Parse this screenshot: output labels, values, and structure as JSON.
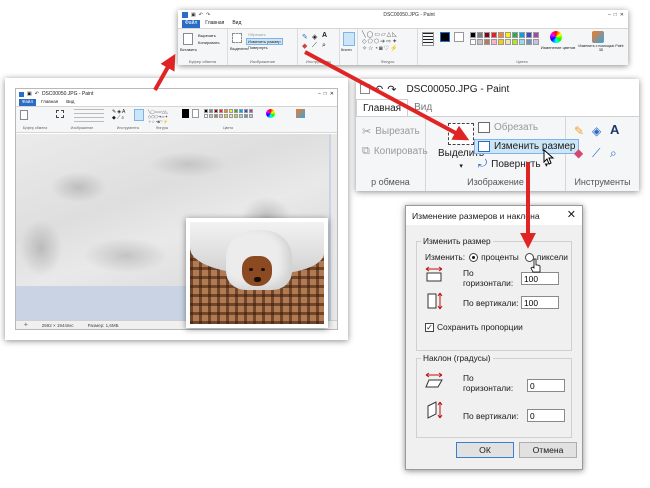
{
  "top_strip": {
    "title": "DSC00050.JPG - Paint",
    "tabs": [
      "Файл",
      "Главная",
      "Вид"
    ],
    "groups": [
      "Буфер обмена",
      "Изображение",
      "Инструменты",
      "Фигуры",
      "Цвета"
    ],
    "labels": {
      "cut": "Вырезать",
      "copy": "Копировать",
      "paste": "Вставить",
      "select": "Выделить",
      "crop": "Обрезать",
      "resize": "Изменить размер",
      "rotate": "Повернуть",
      "brushes": "Кисти",
      "thickness": "Толщина",
      "color1": "Цвет 1",
      "color2": "Цвет 2",
      "edit_colors": "Изменение цветов",
      "paint3d": "Изменить с помощью Paint 3D"
    }
  },
  "left_window": {
    "title": "DSC00050.JPG - Paint",
    "tabs": [
      "Файл",
      "Главная",
      "Вид"
    ],
    "groups": [
      "Буфер обмена",
      "Изображение",
      "Инструменты",
      "Фигуры",
      "Цвета"
    ],
    "status": {
      "dimensions": "2592 × 1944пкс",
      "size": "Размер: 1,6МБ"
    }
  },
  "zoom_ribbon": {
    "title": "DSC00050.JPG - Paint",
    "tab_home": "Главная",
    "tab_view": "Вид",
    "cut": "Вырезать",
    "copy": "Копировать",
    "select": "Выделить",
    "crop": "Обрезать",
    "resize": "Изменить размер",
    "rotate": "Повернуть",
    "group_clipboard": "р обмена",
    "group_image": "Изображение",
    "group_tools": "Инструменты"
  },
  "dialog": {
    "title": "Изменение размеров и наклона",
    "resize_section": "Изменить размер",
    "by_label": "Изменить:",
    "percent_option": "проценты",
    "pixels_option": "пиксели",
    "horizontal_label": "По горизонтали:",
    "vertical_label": "По вертикали:",
    "resize_h_value": "100",
    "resize_v_value": "100",
    "keep_ratio": "Сохранить пропорции",
    "skew_section": "Наклон (градусы)",
    "skew_h_value": "0",
    "skew_v_value": "0",
    "ok": "ОК",
    "cancel": "Отмена"
  },
  "palette": [
    "#000000",
    "#7f7f7f",
    "#880015",
    "#ed1c24",
    "#ff7f27",
    "#fff200",
    "#22b14c",
    "#00a2e8",
    "#3f48cc",
    "#a349a4",
    "#ffffff",
    "#c3c3c3",
    "#b97a57",
    "#ffaec9",
    "#ffc90e",
    "#efe4b0",
    "#b5e61d",
    "#99d9ea",
    "#7092be",
    "#c8bfe7"
  ],
  "colors": {
    "arrow": "#e02424",
    "accent": "#2b6cc4"
  }
}
